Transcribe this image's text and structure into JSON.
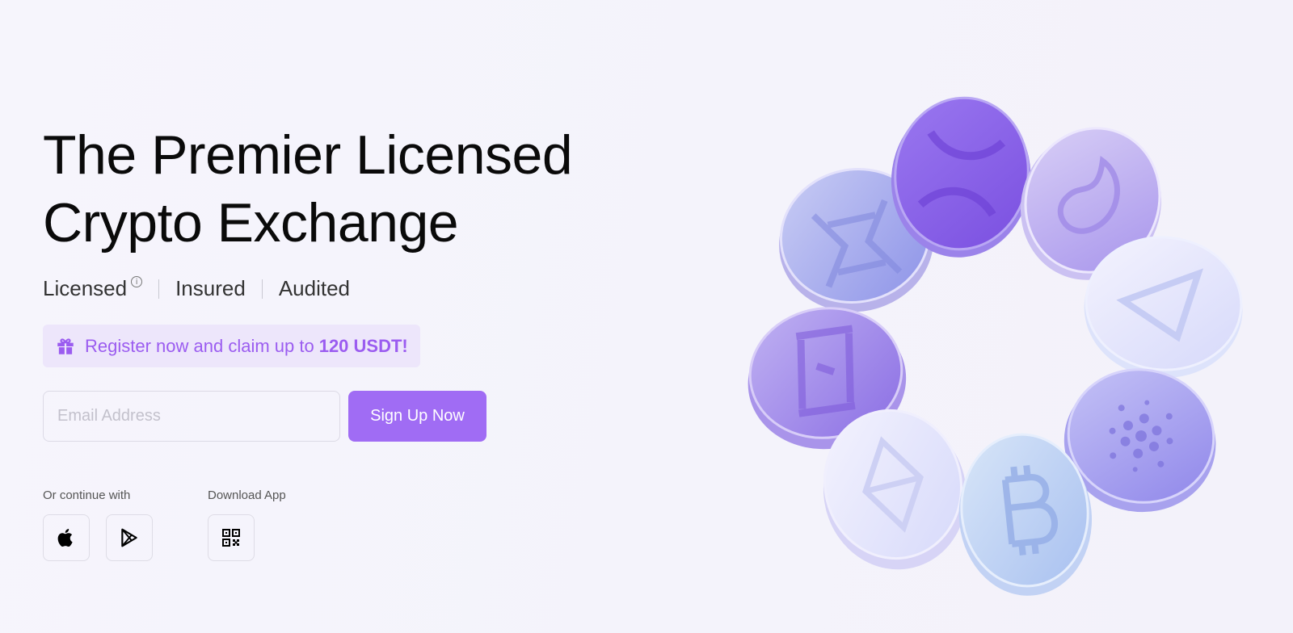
{
  "hero": {
    "title_line1": "The Premier Licensed",
    "title_line2": "Crypto Exchange",
    "badges": [
      "Licensed",
      "Insured",
      "Audited"
    ],
    "info_glyph": "i",
    "promo_text": "Register now and claim up to",
    "promo_amount": "120 USDT!"
  },
  "signup": {
    "email_placeholder": "Email Address",
    "email_value": "",
    "button_label": "Sign Up Now"
  },
  "social": {
    "continue_label": "Or continue with",
    "download_label": "Download App",
    "continue_icons": [
      "apple-icon",
      "google-play-icon"
    ],
    "download_icons": [
      "qr-code-icon"
    ]
  },
  "artwork": {
    "coins": [
      "xrp-coin",
      "solana-coin",
      "telegram-coin",
      "cardano-coin",
      "bitcoin-coin",
      "ethereum-coin",
      "dash-coin",
      "stacks-coin"
    ]
  },
  "colors": {
    "accent": "#a06cf4",
    "promo_text": "#9b5cf0",
    "promo_bg": "#ede6fb"
  }
}
